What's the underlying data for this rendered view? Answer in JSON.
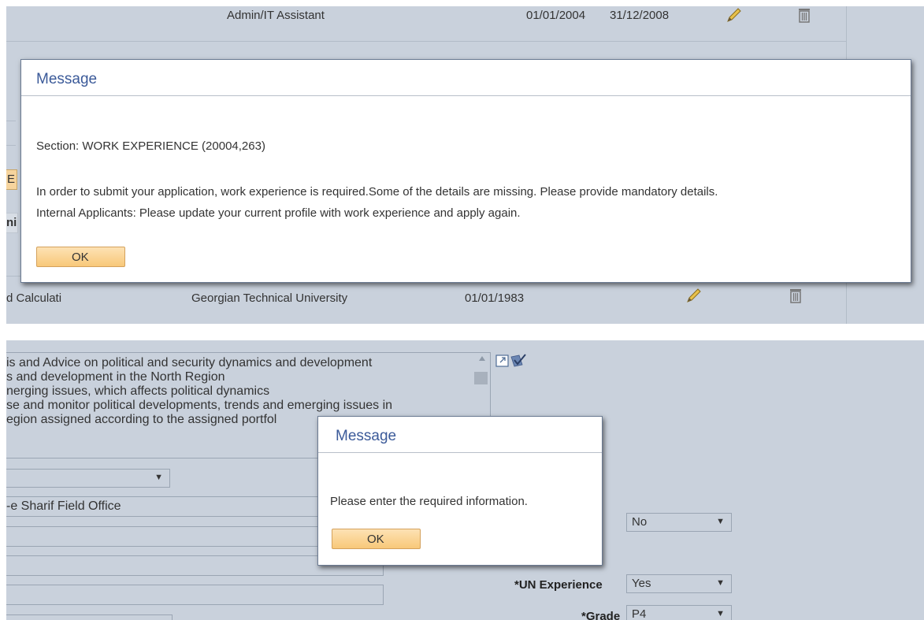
{
  "top": {
    "row1": {
      "title": "Admin/IT Assistant",
      "start": "01/01/2004",
      "end": "31/12/2008"
    },
    "row2": {
      "program": "d Calculati",
      "institution": "Georgian Technical University",
      "date": "01/01/1983"
    },
    "fragments": {
      "button_fragment": "E",
      "tab_fragment": "ni"
    },
    "dialog": {
      "title": "Message",
      "section": "Section: WORK EXPERIENCE (20004,263)",
      "line1": "In order to submit your application, work experience is required.Some of the details are missing. Please provide mandatory details.",
      "line2": "Internal Applicants: Please update your current profile with work experience and apply again.",
      "ok_label": "OK"
    }
  },
  "bottom": {
    "textarea_lines": [
      "is and Advice on political and security dynamics and development",
      "s and development in the North Region",
      "nerging issues, which affects political dynamics",
      "se and monitor political developments, trends and emerging issues in",
      "egion assigned according to the assigned portfol"
    ],
    "office_field": "-e Sharif Field Office",
    "dialog": {
      "title": "Message",
      "text": "Please enter the required information.",
      "ok_label": "OK"
    },
    "select_no": "No",
    "un_experience_label": "*UN Experience",
    "un_experience_value": "Yes",
    "grade_label": "*Grade",
    "grade_value": "P4"
  },
  "colors": {
    "panel_bg": "#c9d1dc",
    "dialog_title": "#3b5a99",
    "ok_button": "#f8c879"
  },
  "icons": [
    "pencil-icon",
    "trash-icon",
    "lookup-icon",
    "spellcheck-icon"
  ]
}
